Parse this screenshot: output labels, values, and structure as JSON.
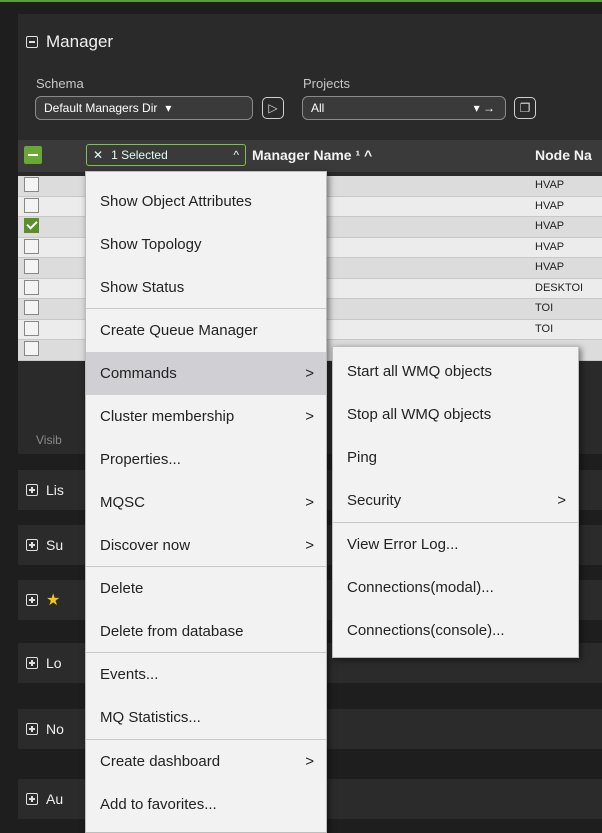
{
  "panel": {
    "title": "Manager",
    "schema_label": "Schema",
    "schema_value": "Default Managers Dir",
    "projects_label": "Projects",
    "projects_value": "All"
  },
  "table": {
    "selected_label": "1 Selected",
    "col_manager": "Manager Name ¹ ^",
    "col_node": "Node Na",
    "rows": [
      {
        "checked": false,
        "node": "HVAP"
      },
      {
        "checked": false,
        "node": "HVAP"
      },
      {
        "checked": true,
        "node": "HVAP"
      },
      {
        "checked": false,
        "node": "HVAP"
      },
      {
        "checked": false,
        "node": "HVAP"
      },
      {
        "checked": false,
        "node": "DESKTOI"
      },
      {
        "checked": false,
        "node": "TOI"
      },
      {
        "checked": false,
        "node": "TOI"
      },
      {
        "checked": false,
        "node": ""
      }
    ],
    "visible_label": "Visib"
  },
  "sections": [
    {
      "label": "Lis"
    },
    {
      "label": "Su"
    },
    {
      "label": ""
    },
    {
      "label": "Lo"
    },
    {
      "label": "No"
    },
    {
      "label": "Au"
    }
  ],
  "context_menu": {
    "items": [
      {
        "label": "Show Object Attributes",
        "submenu": false
      },
      {
        "label": "Show Topology",
        "submenu": false
      },
      {
        "label": "Show Status",
        "submenu": false
      },
      {
        "label": "Create Queue Manager",
        "submenu": false
      },
      {
        "label": "Commands",
        "submenu": true
      },
      {
        "label": "Cluster membership",
        "submenu": true
      },
      {
        "label": "Properties...",
        "submenu": false
      },
      {
        "label": "MQSC",
        "submenu": true
      },
      {
        "label": "Discover now",
        "submenu": true
      },
      {
        "label": "Delete",
        "submenu": false
      },
      {
        "label": "Delete from database",
        "submenu": false
      },
      {
        "label": "Events...",
        "submenu": false
      },
      {
        "label": "MQ Statistics...",
        "submenu": false
      },
      {
        "label": "Create dashboard",
        "submenu": true
      },
      {
        "label": "Add to favorites...",
        "submenu": false
      }
    ]
  },
  "commands_submenu": {
    "items": [
      {
        "label": "Start all WMQ objects",
        "submenu": false
      },
      {
        "label": "Stop all WMQ objects",
        "submenu": false
      },
      {
        "label": "Ping",
        "submenu": false
      },
      {
        "label": "Security",
        "submenu": true
      },
      {
        "label": "View Error Log...",
        "submenu": false
      },
      {
        "label": "Connections(modal)...",
        "submenu": false
      },
      {
        "label": "Connections(console)...",
        "submenu": false
      }
    ]
  },
  "colors": {
    "accent_green": "#6aa834",
    "menu_bg": "#f2f2f2",
    "highlight": "#d0d0d4"
  }
}
